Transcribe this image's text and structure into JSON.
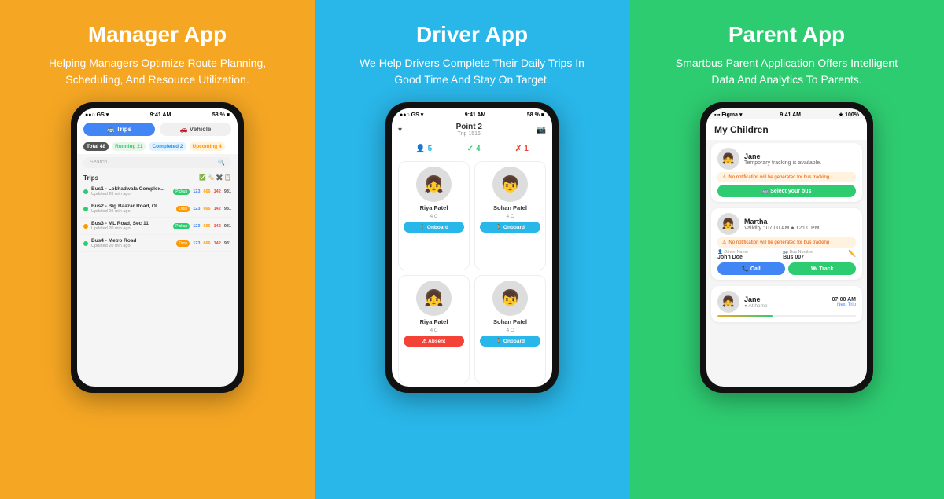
{
  "manager": {
    "title": "Manager App",
    "subtitle": "Helping Managers Optimize Route Planning, Scheduling, And Resource Utilization.",
    "screen": {
      "statusLeft": "●●○ GS ▾",
      "statusTime": "9:41 AM",
      "statusRight": "58 % ■",
      "tab1": "🚌 Trips",
      "tab2": "🚗 Vehicle",
      "total": "Total 48",
      "running": "Running 21",
      "completed": "Completed 2",
      "upcoming": "Upcoming 4",
      "searchPlaceholder": "Search",
      "listHeader": "Trips",
      "trips": [
        {
          "name": "Bus1 - Lokhadwala Complex...",
          "time": "Updated 20 min ago",
          "type": "Pickup",
          "nums": "123  666  142  931",
          "dotColor": "green"
        },
        {
          "name": "Bus2 - Big Baazar Road, Ol...",
          "time": "Updated 20 min ago",
          "type": "Drop",
          "nums": "123  666  142  931",
          "dotColor": "green"
        },
        {
          "name": "Bus3 - ML Road, Sec 11",
          "time": "Updated 20 min ago",
          "type": "Pickup",
          "nums": "123  666  142  931",
          "dotColor": "orange"
        },
        {
          "name": "Bus4 - Metro Road",
          "time": "Updated 20 min ago",
          "type": "Drop",
          "nums": "123  666  142  931",
          "dotColor": "green"
        }
      ]
    }
  },
  "driver": {
    "title": "Driver App",
    "subtitle": "We Help Drivers Complete Their Daily Trips In Good  Time And Stay On Target.",
    "screen": {
      "statusLeft": "●●○ GS ▾",
      "statusTime": "9:41 AM",
      "statusRight": "58 % ■",
      "point": "Point 2",
      "trip": "Trip 1516",
      "stat1": "5",
      "stat2": "4",
      "stat3": "1",
      "cards": [
        {
          "name": "Riya Patel",
          "class": "4 C",
          "btn": "🚶 Onboard",
          "btnType": "normal"
        },
        {
          "name": "Sohan Patel",
          "class": "4 C",
          "btn": "🚶 Onboard",
          "btnType": "normal"
        },
        {
          "name": "Riya Patel",
          "class": "4 C",
          "btn": "⚠ Absent",
          "btnType": "red"
        },
        {
          "name": "Sohan Patel",
          "class": "4 C",
          "btn": "🚶 Onboard",
          "btnType": "normal"
        }
      ]
    }
  },
  "parent": {
    "title": "Parent App",
    "subtitle": "Smartbus Parent Application Offers Intelligent Data And Analytics To Parents.",
    "screen": {
      "statusLeft": "▪▪▪ Figma ▾",
      "statusTime": "9:41 AM",
      "statusRight": "★ 100%",
      "header": "My Children",
      "children": [
        {
          "name": "Jane",
          "status": "Temporary tracking is available.",
          "warning": "No notification will be generated for bus tracking",
          "btn": "🚌 Select your bus",
          "type": "select"
        },
        {
          "name": "Martha",
          "validity": "Validity : 07:00 AM   12:00 PM",
          "warning": "No notification will be generated for bus tracking",
          "driverLabel": "Driver Name",
          "driver": "John Doe",
          "busLabel": "Bus Number",
          "bus": "Bus 007",
          "callBtn": "📞 Call",
          "trackBtn": "🛰 Track",
          "type": "track"
        },
        {
          "name": "Jane",
          "location": "At home",
          "time": "07:00 AM",
          "nextTrip": "Next Trip",
          "type": "trip"
        }
      ]
    }
  }
}
